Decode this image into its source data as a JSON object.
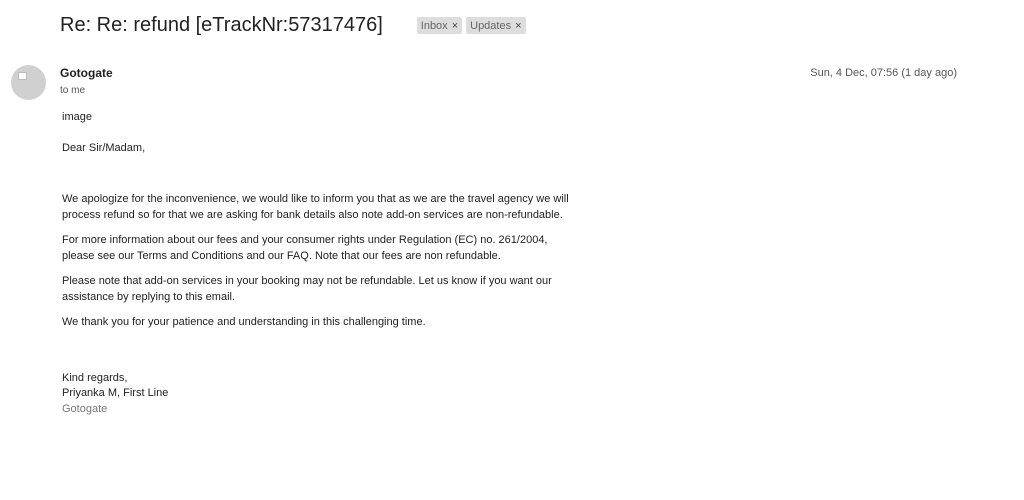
{
  "email": {
    "subject": "Re: Re: refund [eTrackNr:57317476]",
    "labels": [
      {
        "name": "Inbox",
        "remove": "×"
      },
      {
        "name": "Updates",
        "remove": "×"
      }
    ],
    "sender": "Gotogate",
    "recipient": "to me",
    "date": "Sun, 4 Dec, 07:56 (1 day ago)",
    "avatar_icon": "person-placeholder-icon",
    "body": {
      "image_alt": "image",
      "greeting": "Dear Sir/Madam,",
      "paragraphs": [
        "We apologize for the inconvenience, we would like to inform you that as we are the travel agency we will process refund so for that we are asking for bank details also note add-on services are non-refundable.",
        "For more information about our fees and your consumer rights under Regulation (EC) no. 261/2004, please see our Terms and Conditions and our FAQ. Note that our fees are non refundable.",
        "Please note that add-on services in your booking may not be refundable. Let us know if you want our assistance by replying to this email.",
        "We thank you for your patience and understanding in this challenging time."
      ],
      "closing": "Kind regards,",
      "signer": "Priyanka M, First Line",
      "organization": "Gotogate"
    }
  }
}
